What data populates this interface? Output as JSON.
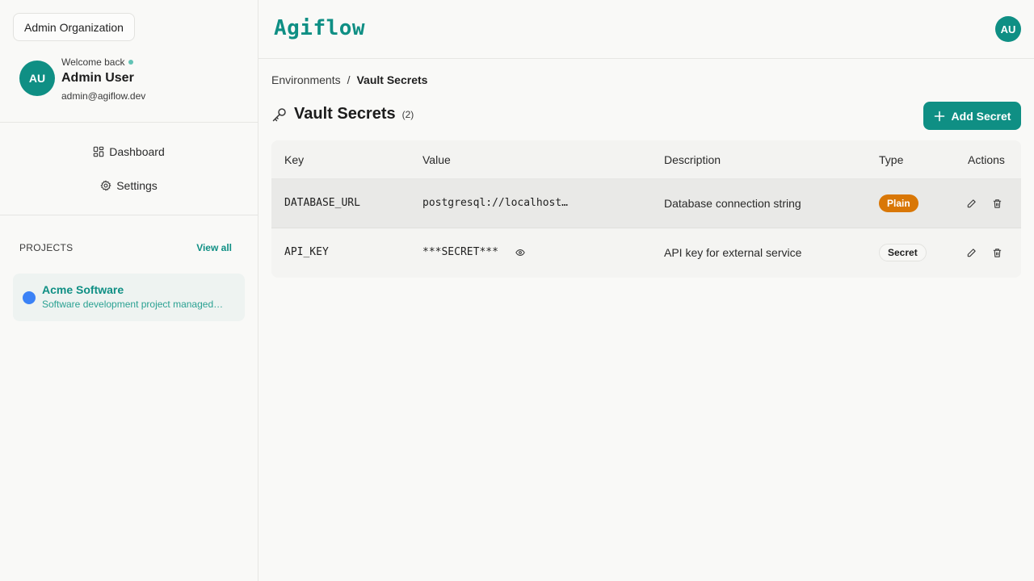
{
  "sidebar": {
    "org_name": "Admin Organization",
    "user": {
      "initials": "AU",
      "welcome": "Welcome back",
      "name": "Admin User",
      "email": "admin@agiflow.dev"
    },
    "nav": [
      {
        "label": "Dashboard",
        "icon": "dashboard-icon"
      },
      {
        "label": "Settings",
        "icon": "gear-icon"
      }
    ],
    "projects_label": "PROJECTS",
    "view_all": "View all",
    "projects": [
      {
        "name": "Acme Software",
        "description": "Software development project managed…",
        "color": "#3b82f6"
      }
    ]
  },
  "header": {
    "logo": "Agiflow",
    "avatar_initials": "AU"
  },
  "breadcrumb": {
    "parent": "Environments",
    "separator": "/",
    "current": "Vault Secrets"
  },
  "page": {
    "title": "Vault Secrets",
    "count": "(2)",
    "add_button": "Add Secret"
  },
  "table": {
    "columns": [
      "Key",
      "Value",
      "Description",
      "Type",
      "Actions"
    ],
    "rows": [
      {
        "key": "DATABASE_URL",
        "value": "postgresql://localhost…",
        "description": "Database connection string",
        "type": "Plain"
      },
      {
        "key": "API_KEY",
        "value": "***SECRET***",
        "description": "API key for external service",
        "type": "Secret"
      }
    ]
  },
  "colors": {
    "accent": "#0f8f84",
    "plain_badge": "#d97706",
    "project_dot": "#3b82f6"
  }
}
